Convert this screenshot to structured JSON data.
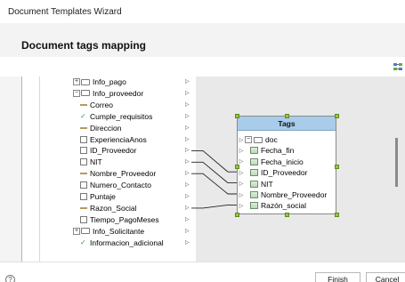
{
  "window": {
    "title": "Document Templates Wizard"
  },
  "page": {
    "title": "Document tags mapping"
  },
  "source_tree": {
    "items": [
      {
        "label": "Info_pago",
        "icon": "folder"
      },
      {
        "label": "Info_proveedor",
        "icon": "folder"
      },
      {
        "label": "Correo",
        "icon": "dash"
      },
      {
        "label": "Cumple_requisitos",
        "icon": "check"
      },
      {
        "label": "Direccion",
        "icon": "dash"
      },
      {
        "label": "ExperienciaAnos",
        "icon": "field"
      },
      {
        "label": "ID_Proveedor",
        "icon": "field"
      },
      {
        "label": "NIT",
        "icon": "field"
      },
      {
        "label": "Nombre_Proveedor",
        "icon": "dash"
      },
      {
        "label": "Numero_Contacto",
        "icon": "field"
      },
      {
        "label": "Puntaje",
        "icon": "field"
      },
      {
        "label": "Razon_Social",
        "icon": "dash"
      },
      {
        "label": "Tiempo_PagoMeses",
        "icon": "field"
      },
      {
        "label": "Info_Solicitante",
        "icon": "folder"
      },
      {
        "label": "Informacion_adicional",
        "icon": "check"
      }
    ]
  },
  "tags_panel": {
    "title": "Tags",
    "root": "doc",
    "items": [
      "Fecha_fin",
      "Fecha_inicio",
      "ID_Proveedor",
      "NIT",
      "Nombre_Proveedor",
      "Razón_social"
    ]
  },
  "mappings": [
    {
      "from": "ID_Proveedor",
      "to": "ID_Proveedor"
    },
    {
      "from": "NIT",
      "to": "NIT"
    },
    {
      "from": "Nombre_Proveedor",
      "to": "Nombre_Proveedor"
    },
    {
      "from": "Razon_Social",
      "to": "Razón_social"
    }
  ],
  "footer": {
    "finish_label": "Finish",
    "cancel_label": "Cancel",
    "help_symbol": "?"
  }
}
